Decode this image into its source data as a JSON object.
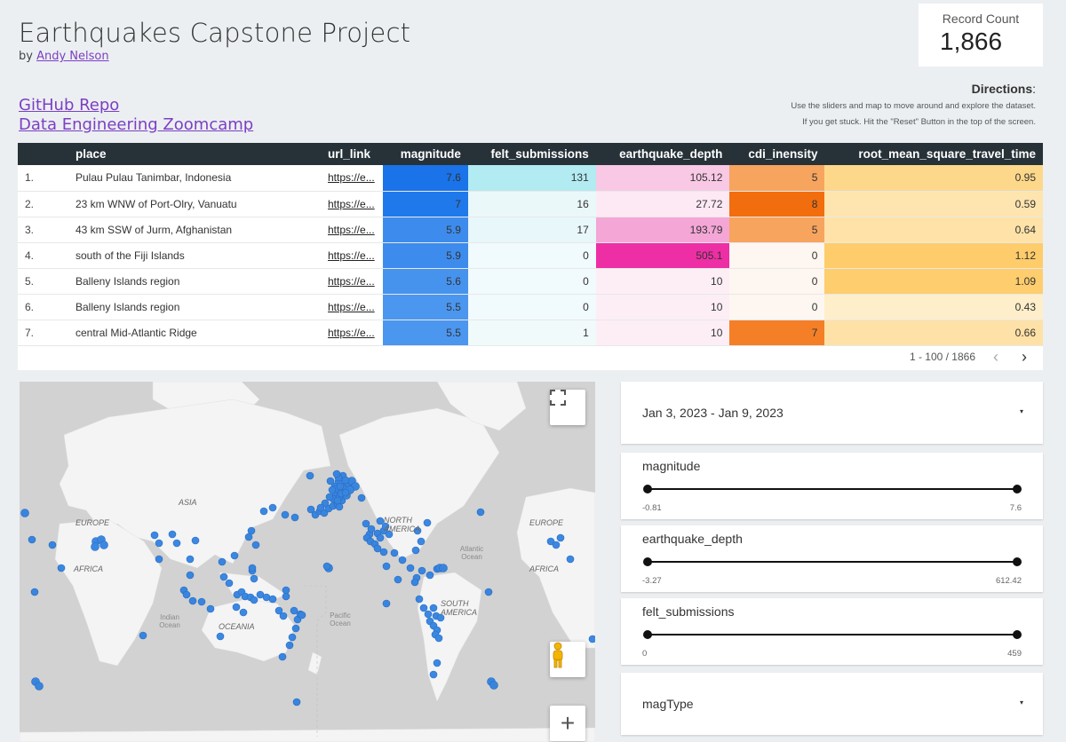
{
  "header": {
    "title": "Earthquakes Capstone Project",
    "by_prefix": "by",
    "author": "Andy Nelson"
  },
  "record_count": {
    "label": "Record Count",
    "value": "1,866"
  },
  "links": {
    "github": "GitHub Repo",
    "zoomcamp": "Data Engineering Zoomcamp"
  },
  "directions": {
    "title": "Directions",
    "colon": ":",
    "line1": "Use the sliders and map to move around and explore the dataset.",
    "line2": "If you get stuck. Hit the \"Reset\" Button in the top of the screen."
  },
  "table": {
    "columns": [
      "",
      "place",
      "url_link",
      "magnitude",
      "felt_submissions",
      "earthquake_depth",
      "cdi_inensity",
      "root_mean_square_travel_time"
    ],
    "rows": [
      [
        "1.",
        "Pulau Pulau Tanimbar, Indonesia",
        "https://e...",
        "7.6",
        "131",
        "105.12",
        "5",
        "0.95"
      ],
      [
        "2.",
        "23 km WNW of Port-Olry, Vanuatu",
        "https://e...",
        "7",
        "16",
        "27.72",
        "8",
        "0.59"
      ],
      [
        "3.",
        "43 km SSW of Jurm, Afghanistan",
        "https://e...",
        "5.9",
        "17",
        "193.79",
        "5",
        "0.64"
      ],
      [
        "4.",
        "south of the Fiji Islands",
        "https://e...",
        "5.9",
        "0",
        "505.1",
        "0",
        "1.12"
      ],
      [
        "5.",
        "Balleny Islands region",
        "https://e...",
        "5.6",
        "0",
        "10",
        "0",
        "1.09"
      ],
      [
        "6.",
        "Balleny Islands region",
        "https://e...",
        "5.5",
        "0",
        "10",
        "0",
        "0.43"
      ],
      [
        "7.",
        "central Mid-Atlantic Ridge",
        "https://e...",
        "5.5",
        "1",
        "10",
        "7",
        "0.66"
      ]
    ],
    "heat_colors": {
      "magnitude": [
        "#1a73e8",
        "#2079ea",
        "#3d8ced",
        "#3d8ced",
        "#4693ee",
        "#4b96ef",
        "#4b96ef"
      ],
      "felt_submissions": [
        "#b2ebf2",
        "#eaf8fa",
        "#e8f7fa",
        "#f1fafc",
        "#f1fafc",
        "#f1fafc",
        "#f0fafb"
      ],
      "earthquake_depth": [
        "#f8c8e4",
        "#fde9f4",
        "#f4a6d6",
        "#ee2ea5",
        "#fdeef6",
        "#fdeef6",
        "#fdeef6"
      ],
      "cdi_inensity": [
        "#f7a45e",
        "#f26d0d",
        "#f7a45e",
        "#fef6f0",
        "#fef6f0",
        "#fef6f0",
        "#f47f27"
      ],
      "rmstt": [
        "#fed88a",
        "#fee4ae",
        "#fee2a8",
        "#fecc6a",
        "#fecd6e",
        "#feeec9",
        "#fee1a6"
      ]
    },
    "pagination": {
      "range": "1 - 100 / 1866",
      "prev": "‹",
      "next": "›"
    }
  },
  "map": {
    "labels": {
      "asia": "ASIA",
      "europe_left": "EUROPE",
      "africa_left": "AFRICA",
      "north_america": "NORTH AMERICA",
      "europe_right": "EUROPE",
      "africa_right": "AFRICA",
      "south_america": "SOUTH AMERICA",
      "oceania": "OCEANIA"
    },
    "oceans": {
      "indian": "Indian Ocean",
      "pacific": "Pacific Ocean",
      "atlantic": "Atlantic Ocean"
    },
    "zoom_in": "+"
  },
  "filters": {
    "date_range": "Jan 3, 2023 - Jan 9, 2023",
    "magnitude": {
      "name": "magnitude",
      "min": "-0.81",
      "max": "7.6"
    },
    "depth": {
      "name": "earthquake_depth",
      "min": "-3.27",
      "max": "612.42"
    },
    "felt": {
      "name": "felt_submissions",
      "min": "0",
      "max": "459"
    },
    "magtype": "magType",
    "caret": "▾"
  }
}
